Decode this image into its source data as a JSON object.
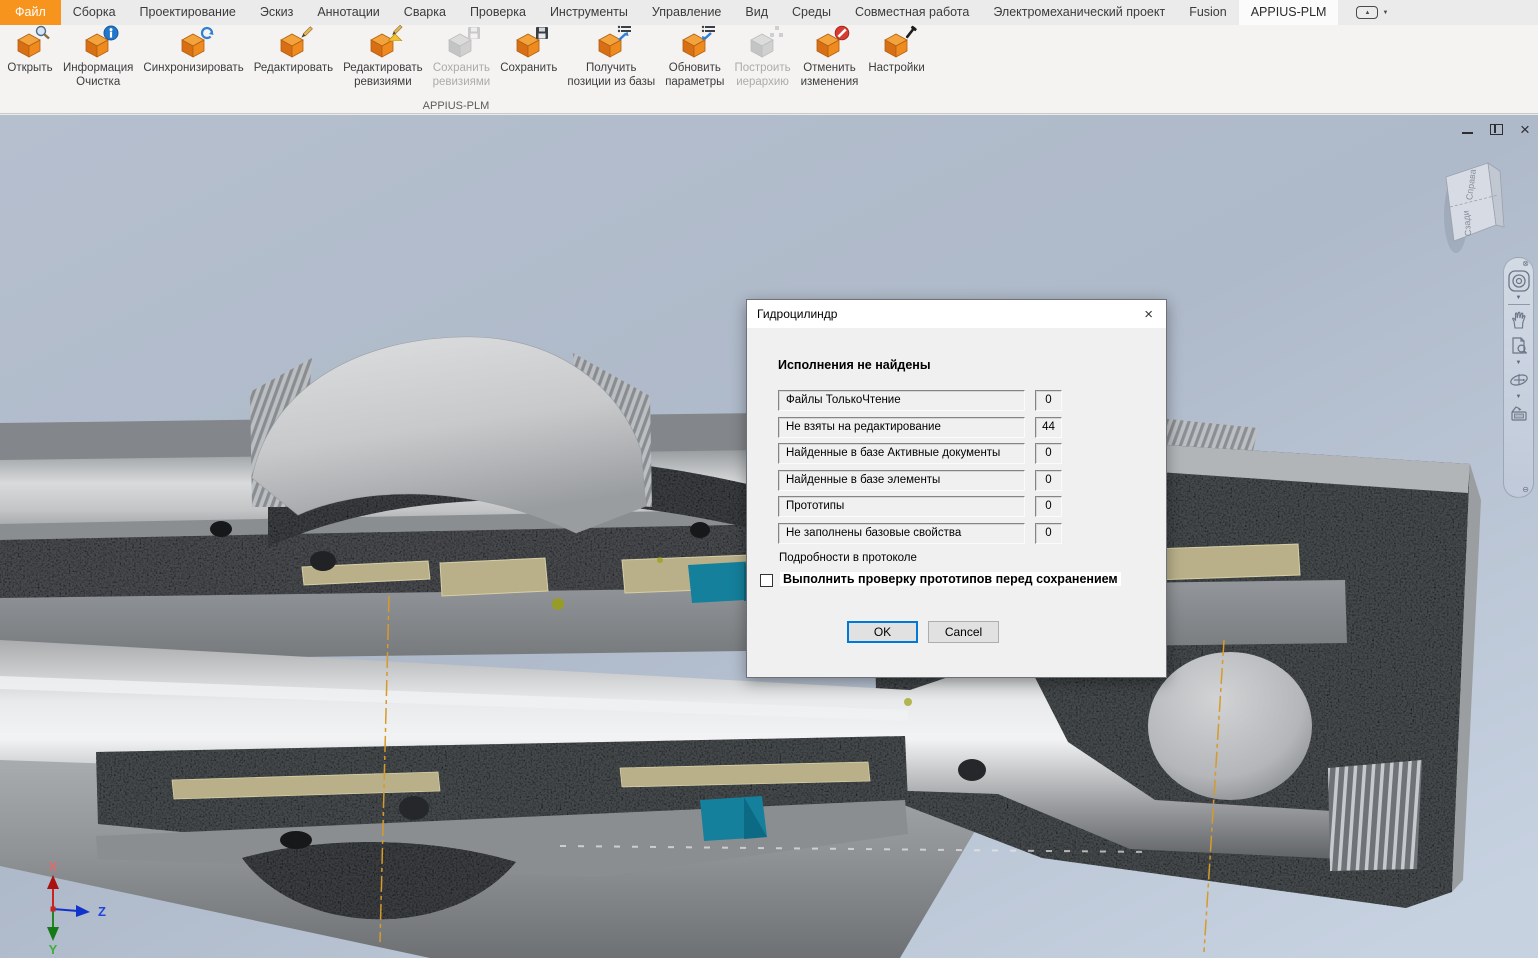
{
  "menu": {
    "tabs": [
      {
        "label": "Файл",
        "style": "file"
      },
      {
        "label": "Сборка"
      },
      {
        "label": "Проектирование"
      },
      {
        "label": "Эскиз"
      },
      {
        "label": "Аннотации"
      },
      {
        "label": "Сварка"
      },
      {
        "label": "Проверка"
      },
      {
        "label": "Инструменты"
      },
      {
        "label": "Управление"
      },
      {
        "label": "Вид"
      },
      {
        "label": "Среды"
      },
      {
        "label": "Совместная работа"
      },
      {
        "label": "Электромеханический проект"
      },
      {
        "label": "Fusion"
      },
      {
        "label": "APPIUS-PLM",
        "active": true
      }
    ]
  },
  "ribbon": {
    "panel_label": "APPIUS-PLM",
    "buttons": [
      {
        "line1": "Открыть",
        "line2": "",
        "icon": "open-search",
        "disabled": false
      },
      {
        "line1": "Информация",
        "line2": "Очистка",
        "icon": "info",
        "disabled": false
      },
      {
        "line1": "Синхронизировать",
        "line2": "",
        "icon": "sync",
        "disabled": false
      },
      {
        "line1": "Редактировать",
        "line2": "",
        "icon": "edit",
        "disabled": false
      },
      {
        "line1": "Редактировать",
        "line2": "ревизиями",
        "icon": "edit-revisions",
        "disabled": false
      },
      {
        "line1": "Сохранить",
        "line2": "ревизиями",
        "icon": "save-revisions",
        "disabled": true
      },
      {
        "line1": "Сохранить",
        "line2": "",
        "icon": "save",
        "disabled": false
      },
      {
        "line1": "Получить",
        "line2": "позиции из базы",
        "icon": "get-positions",
        "disabled": false
      },
      {
        "line1": "Обновить",
        "line2": "параметры",
        "icon": "update-params",
        "disabled": false
      },
      {
        "line1": "Построить",
        "line2": "иерархию",
        "icon": "build-hierarchy",
        "disabled": true
      },
      {
        "line1": "Отменить",
        "line2": "изменения",
        "icon": "cancel-changes",
        "disabled": false
      },
      {
        "line1": "Настройки",
        "line2": "",
        "icon": "settings",
        "disabled": false
      }
    ]
  },
  "dialog": {
    "title": "Гидроцилиндр",
    "header": "Исполнения не найдены",
    "rows": [
      {
        "label": "Файлы ТолькоЧтение",
        "value": "0"
      },
      {
        "label": "Не взяты на редактирование",
        "value": "44"
      },
      {
        "label": "Найденные в базе Активные документы",
        "value": "0"
      },
      {
        "label": "Найденные в базе элементы",
        "value": "0"
      },
      {
        "label": "Прототипы",
        "value": "0"
      },
      {
        "label": "Не заполнены базовые свойства",
        "value": "0"
      }
    ],
    "note": "Подробности в протоколе",
    "checkbox_label": "Выполнить проверку прототипов перед сохранением",
    "checkbox_checked": false,
    "buttons": {
      "ok": "OK",
      "cancel": "Cancel"
    }
  },
  "viewport": {
    "viewcube": {
      "top_face": "Справа",
      "front_face": "Сзади"
    },
    "axes": {
      "x": "X",
      "y": "Y",
      "z": "Z"
    }
  },
  "colors": {
    "accent_orange": "#f7941e",
    "focus_blue": "#0078d7",
    "seal_teal": "#15809c",
    "centerline_orange": "#d79a2b",
    "section_dark": "#45484c"
  }
}
